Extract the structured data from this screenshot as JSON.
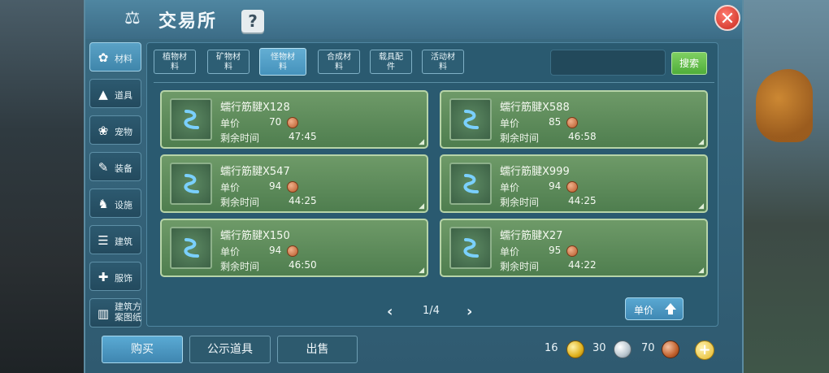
{
  "header": {
    "title": "交易所",
    "help": "?",
    "close": "✕"
  },
  "sidebar": {
    "items": [
      {
        "label": "材料",
        "icon": "✿"
      },
      {
        "label": "道具",
        "icon": "▲"
      },
      {
        "label": "宠物",
        "icon": "❀"
      },
      {
        "label": "装备",
        "icon": "✎"
      },
      {
        "label": "设施",
        "icon": "♞"
      },
      {
        "label": "建筑",
        "icon": "☰"
      },
      {
        "label": "服饰",
        "icon": "✚"
      },
      {
        "label": "建筑方案图纸",
        "line1": "建筑方",
        "line2": "案图纸",
        "icon": "▥"
      }
    ]
  },
  "tabs": [
    {
      "line1": "植物材",
      "line2": "料"
    },
    {
      "line1": "矿物材",
      "line2": "料"
    },
    {
      "line1": "怪物材",
      "line2": "料"
    },
    {
      "line1": "合成材",
      "line2": "料"
    },
    {
      "line1": "载具配",
      "line2": "件"
    },
    {
      "line1": "活动材",
      "line2": "料"
    }
  ],
  "search": {
    "value": "",
    "button_label": "搜索"
  },
  "listing_labels": {
    "price": "单价",
    "time": "剩余时间"
  },
  "listings": [
    {
      "name": "蠕行筋腱X128",
      "price": "70",
      "time": "47:45"
    },
    {
      "name": "蠕行筋腱X588",
      "price": "85",
      "time": "46:58"
    },
    {
      "name": "蠕行筋腱X547",
      "price": "94",
      "time": "44:25"
    },
    {
      "name": "蠕行筋腱X999",
      "price": "94",
      "time": "44:25"
    },
    {
      "name": "蠕行筋腱X150",
      "price": "94",
      "time": "46:50"
    },
    {
      "name": "蠕行筋腱X27",
      "price": "95",
      "time": "44:22"
    }
  ],
  "pager": {
    "prev": "‹",
    "text": "1/4",
    "next": "›"
  },
  "sort": {
    "label": "单价"
  },
  "bottom": {
    "buy": "购买",
    "public": "公示道具",
    "sell": "出售"
  },
  "currency": {
    "gold": "16",
    "silver": "30",
    "copper": "70",
    "add": "+"
  },
  "colors": {
    "accent": "#4592bc",
    "card": "#5e8c5c",
    "search": "#5db548",
    "close": "#d8342a"
  }
}
